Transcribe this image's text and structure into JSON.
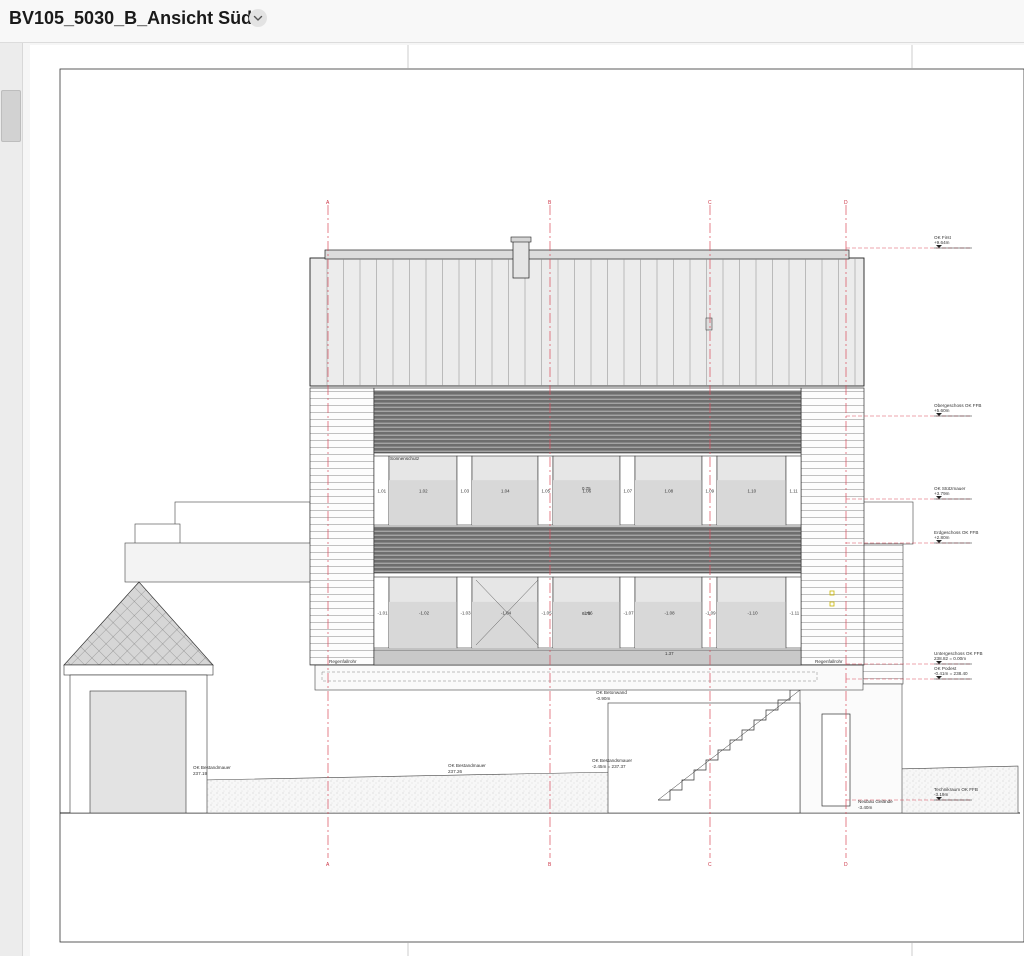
{
  "window": {
    "title": "BV105_5030_B_Ansicht Süd",
    "title_menu_icon": "chevron-down-icon"
  },
  "axes": [
    "A",
    "B",
    "C",
    "D"
  ],
  "levels": [
    {
      "label": "OK First",
      "value": "+9.64m"
    },
    {
      "label": "Obergeschoss OK FFB",
      "value": "+5.60m"
    },
    {
      "label": "OK Stützmauer",
      "value": "+3.79m"
    },
    {
      "label": "Erdgeschoss OK FFB",
      "value": "+2.80m"
    },
    {
      "label": "Untergeschoss OK FFB",
      "value": "238.82 = 0.00m"
    },
    {
      "label": "OK Podest",
      "value": "-0.41m = 238.40"
    },
    {
      "label": "Technikraum OK FFB",
      "value": "-3.19m"
    }
  ],
  "annotations": {
    "sonnenschutz": "Sonnenschutz",
    "regenfallrohr_left": "Regenfallrohr",
    "regenfallrohr_right": "Regenfallrohr",
    "betonwand": "OK Betonwand",
    "betonwand_value": "-0.90m",
    "bestandmauer_1": "OK Bestandmauer",
    "bestandmauer_1_value": "237.19",
    "bestandmauer_2": "OK Bestandmauer",
    "bestandmauer_2_value": "237.26",
    "bestandmauer_3": "OK Bestandsmauer",
    "bestandmauer_3_value": "-2.45m = 237.37",
    "neubau_kante": "Neubau Gelände",
    "neubau_kante_value": "-3.40m"
  },
  "dimensions": {
    "upper_widths": [
      "1.01",
      "1.02",
      "1.03",
      "1.04",
      "1.05",
      "1.06",
      "1.07",
      "1.08",
      "1.09",
      "1.10",
      "1.11"
    ],
    "lower_widths": [
      "-1.01",
      "-1.02",
      "-1.03",
      "-1.04",
      "-1.05",
      "-1.06",
      "-1.07",
      "-1.08",
      "-1.09",
      "-1.10",
      "-1.11"
    ],
    "upper_center": "0.75",
    "lower_center": "0.75",
    "stair_width": "1.37"
  }
}
